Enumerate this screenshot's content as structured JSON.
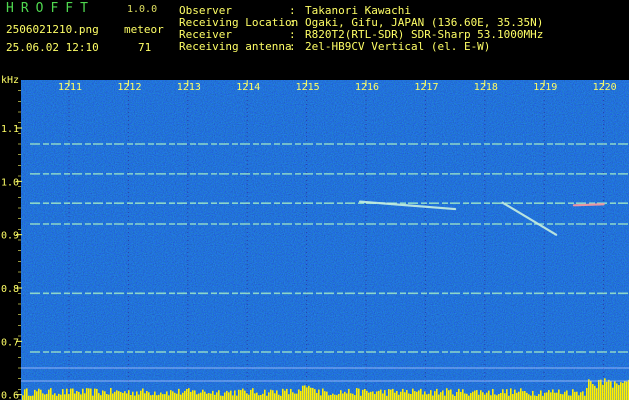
{
  "app": {
    "title": "HROFFT",
    "version": "1.0.0"
  },
  "file": {
    "name": "2506021210.png",
    "datetime": "25.06.02 12:10"
  },
  "mode": {
    "label": "meteor",
    "count": "71"
  },
  "info": [
    {
      "label": "Observer",
      "value": "Takanori Kawachi"
    },
    {
      "label": "Receiving Location",
      "value": "Ogaki, Gifu, JAPAN (136.60E, 35.35N)"
    },
    {
      "label": "Receiver",
      "value": "R820T2(RTL-SDR) SDR-Sharp 53.1000MHz"
    },
    {
      "label": "Receiving antenna",
      "value": "2el-HB9CV Vertical (el. E-W)"
    }
  ],
  "axis": {
    "y_unit": "kHz",
    "y_ticks": [
      "1.1",
      "1.0",
      "0.9",
      "0.8",
      "0.7",
      "0.6"
    ],
    "x_ticks": [
      "1211",
      "1212",
      "1213",
      "1214",
      "1215",
      "1216",
      "1217",
      "1218",
      "1219",
      "1220"
    ]
  },
  "colors": {
    "background": "#000000",
    "plot_noise": "#0a1a8a",
    "text": "#ffff66",
    "title": "#4fd84f",
    "carrier": "#9fe8c8",
    "meteor_trail": "#c8f0e0",
    "meteor_head": "#ff9aa0",
    "signal_bar": "#ffee00"
  },
  "chart_data": {
    "type": "heatmap",
    "ylabel": "kHz",
    "x_ticks": [
      "1211",
      "1212",
      "1213",
      "1214",
      "1215",
      "1216",
      "1217",
      "1218",
      "1219",
      "1220"
    ],
    "y_ticks": [
      1.1,
      1.0,
      0.9,
      0.8,
      0.7,
      0.6
    ],
    "ylim": [
      0.59,
      1.19
    ],
    "carriers_khz": [
      1.07,
      1.014,
      0.959,
      0.92,
      0.79,
      0.68
    ],
    "meteor_echoes": [
      {
        "name": "echo",
        "x_start": "1215.9",
        "x_end": "1217.5",
        "y_start": 0.962,
        "y_end": 0.948
      },
      {
        "name": "echo",
        "x_start": "1218.3",
        "x_end": "1219.2",
        "y_start": 0.96,
        "y_end": 0.9
      },
      {
        "name": "echo",
        "x_start": "1219.5",
        "x_end": "1220",
        "y_start": 0.955,
        "y_end": 0.957
      }
    ]
  }
}
